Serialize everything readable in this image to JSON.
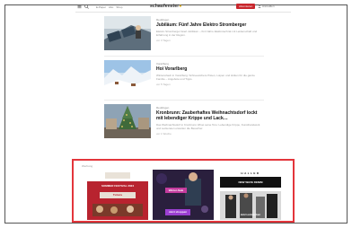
{
  "topbar": {
    "nav_links": [
      "E-Paper",
      "Abo",
      "Shop"
    ],
    "logo_text": "schaufenster",
    "subscribe_label": "Abonnieren",
    "login_label": "Anmelden"
  },
  "articles": [
    {
      "category": "Reutlingen",
      "title": "Jubiläum: Fünf Jahre Elektro Stromberger",
      "teaser": "Elektro Stromberger feiert Jubiläum – fünf Jahre Elektrotechnik mit Leidenschaft und Erfahrung in der Region.",
      "meta": "vor 3 Tagen"
    },
    {
      "category": "Vorarlberg",
      "title": "Hoi Vorarlberg",
      "teaser": "Winterurlaub in Vorarlberg: Schneesichere Pisten, Loipen und Hütten für die ganze Familie – Angebote und Tipps.",
      "meta": "vor 5 Tagen"
    },
    {
      "category": "Reutlingen",
      "title": "Kronbrunn: Zauberhaftes Weihnachtsdorf lockt mit lebendiger Krippe und Lack…",
      "teaser": "Das Weihnachtsdorf in Kronbrunn öffnet seine Tore: Lebendige Krippe, Kunsthandwerk und Leckereien erwarten die Besucher.",
      "meta": "vor 1 Woche"
    }
  ],
  "ads_section": {
    "label": "Werbung",
    "ads": [
      {
        "name": "ad-1",
        "headline": "SOMMER FESTIVAL 2024",
        "cta": "Tickets"
      },
      {
        "name": "ad-2",
        "headline": "Winter-Sale",
        "cta": "Jetzt shoppen"
      },
      {
        "name": "ad-3",
        "brand": "HALLER",
        "headline": "NEW WAVE DENIM",
        "cta": "Jetzt entdecken"
      }
    ]
  },
  "colors": {
    "accent_red": "#c8262c",
    "highlight_border": "#e3353b",
    "logo_dot": "#d7a81a"
  }
}
